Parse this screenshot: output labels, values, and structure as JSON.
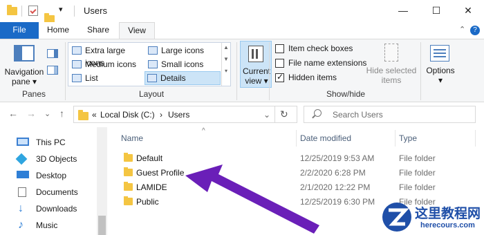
{
  "window": {
    "title": "Users",
    "minimize_glyph": "—",
    "maximize_glyph": "☐",
    "close_glyph": "✕"
  },
  "ribbon_tabs": {
    "file": "File",
    "home": "Home",
    "share": "Share",
    "view": "View",
    "collapse_glyph": "⌃",
    "help_glyph": "?"
  },
  "panes_group": {
    "navigation_pane_line1": "Navigation",
    "navigation_pane_line2": "pane ▾",
    "label": "Panes"
  },
  "layout_group": {
    "extra_large": "Extra large icons",
    "large": "Large icons",
    "medium": "Medium icons",
    "small": "Small icons",
    "list": "List",
    "details": "Details",
    "label": "Layout",
    "selected": "Details"
  },
  "current_view": {
    "line1": "Current",
    "line2": "view ▾"
  },
  "showhide_group": {
    "item_check_boxes": "Item check boxes",
    "item_check_boxes_checked": false,
    "file_name_extensions": "File name extensions",
    "file_name_extensions_checked": false,
    "hidden_items": "Hidden items",
    "hidden_items_checked": true,
    "hide_selected_line1": "Hide selected",
    "hide_selected_line2": "items",
    "options": "Options",
    "options_arrow": "▾",
    "label": "Show/hide"
  },
  "navigation": {
    "back_glyph": "←",
    "forward_glyph": "→",
    "recent_glyph": "⌄",
    "up_glyph": "↑",
    "breadcrumb_overflow": "«",
    "breadcrumb_parent": "Local Disk (C:)",
    "breadcrumb_sep": "›",
    "breadcrumb_current": "Users",
    "refresh_glyph": "↻",
    "search_placeholder": "Search Users"
  },
  "tree": [
    {
      "label": "This PC",
      "icon": "monitor-icon"
    },
    {
      "label": "3D Objects",
      "icon": "cube-icon"
    },
    {
      "label": "Desktop",
      "icon": "desktop-icon"
    },
    {
      "label": "Documents",
      "icon": "document-icon"
    },
    {
      "label": "Downloads",
      "icon": "download-icon"
    },
    {
      "label": "Music",
      "icon": "music-icon"
    }
  ],
  "columns": {
    "name": "Name",
    "date_modified": "Date modified",
    "type": "Type",
    "sort_glyph": "^"
  },
  "files": [
    {
      "name": "Default",
      "date": "12/25/2019 9:53 AM",
      "type": "File folder"
    },
    {
      "name": "Guest Profile",
      "date": "2/2/2020 6:28 PM",
      "type": "File folder"
    },
    {
      "name": "LAMIDE",
      "date": "2/1/2020 12:22 PM",
      "type": "File folder"
    },
    {
      "name": "Public",
      "date": "12/25/2019 6:30 PM",
      "type": "File folder"
    }
  ],
  "watermark": {
    "title": "这里教程网",
    "url": "herecours.com"
  },
  "colors": {
    "file_tab": "#1a6ac7",
    "arrow": "#6a1fb8",
    "folder": "#f4c542"
  }
}
